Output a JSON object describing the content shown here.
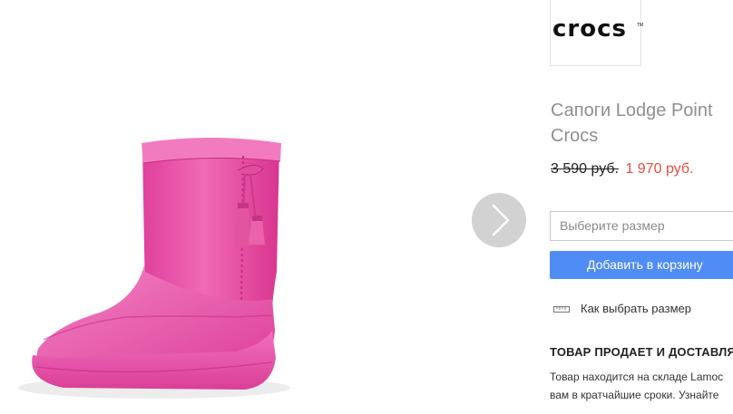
{
  "brand": {
    "logo_text": "crocs",
    "logo_tm": "TM"
  },
  "product": {
    "title_line1": "Сапоги Lodge Point",
    "title_line2": "Crocs",
    "old_price": "3 590 руб.",
    "new_price": "1 970 руб.",
    "image_icon": "pink-boot-image",
    "boot_color": "#e94fa5"
  },
  "gallery": {
    "next_icon": "chevron-right-icon"
  },
  "size": {
    "placeholder": "Выберите размер"
  },
  "cart": {
    "add_label": "Добавить в корзину",
    "button_color": "#4f8df5"
  },
  "size_guide": {
    "label": "Как выбрать размер",
    "icon": "ruler-icon"
  },
  "seller": {
    "heading": "ТОВАР ПРОДАЕТ И ДОСТАВЛЯЕ",
    "text_line1": "Товар находится на складе Lamoc",
    "text_line2": "вам в кратчайшие сроки. Узнайте"
  },
  "colors": {
    "price_new": "#e84c3d",
    "title": "#8f8f8f"
  }
}
